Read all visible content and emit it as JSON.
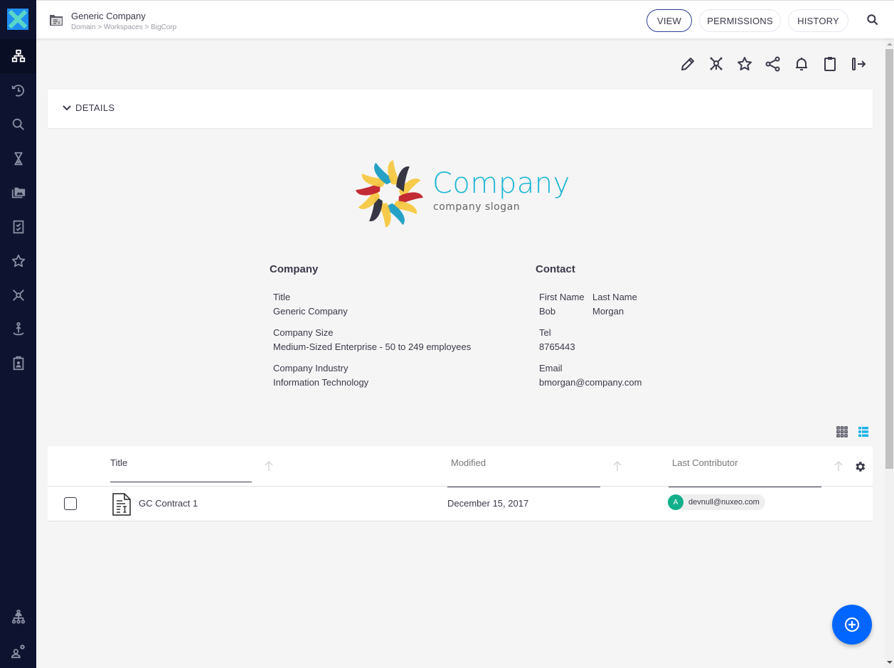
{
  "header": {
    "title": "Generic Company",
    "breadcrumb": "Domain > Workspaces > BigCorp",
    "tabs": [
      {
        "label": "VIEW",
        "active": true
      },
      {
        "label": "PERMISSIONS",
        "active": false
      },
      {
        "label": "HISTORY",
        "active": false
      }
    ]
  },
  "sidebar": {
    "items": [
      {
        "icon": "browse-tree-icon",
        "active": true
      },
      {
        "icon": "recent-history-icon"
      },
      {
        "icon": "search-icon"
      },
      {
        "icon": "hourglass-icon"
      },
      {
        "icon": "gallery-icon"
      },
      {
        "icon": "tasks-icon"
      },
      {
        "icon": "star-icon"
      },
      {
        "icon": "collections-icon"
      },
      {
        "icon": "personal-workspace-icon"
      },
      {
        "icon": "clipboard-user-icon"
      }
    ],
    "bottom_items": [
      {
        "icon": "org-chart-icon"
      },
      {
        "icon": "user-settings-icon"
      }
    ]
  },
  "actions": [
    "edit",
    "add-to-collection",
    "favorite",
    "share",
    "subscribe",
    "add-to-clipboard",
    "export"
  ],
  "details": {
    "toggle_label": "DETAILS"
  },
  "logo": {
    "name": "Company",
    "slogan": "company slogan",
    "colors": [
      "#f5c842",
      "#c0202a",
      "#1a9dc4",
      "#2b2b3a"
    ]
  },
  "company": {
    "heading": "Company",
    "fields": [
      {
        "label": "Title",
        "value": "Generic Company"
      },
      {
        "label": "Company Size",
        "value": "Medium-Sized Enterprise - 50 to 249 employees"
      },
      {
        "label": "Company Industry",
        "value": "Information Technology"
      }
    ]
  },
  "contact": {
    "heading": "Contact",
    "first_name_label": "First Name",
    "first_name": "Bob",
    "last_name_label": "Last Name",
    "last_name": "Morgan",
    "tel_label": "Tel",
    "tel": "8765443",
    "email_label": "Email",
    "email": "bmorgan@company.com"
  },
  "table": {
    "columns": [
      {
        "label": "Title"
      },
      {
        "label": "Modified"
      },
      {
        "label": "Last Contributor"
      }
    ],
    "rows": [
      {
        "title": "GC Contract 1",
        "modified": "December 15, 2017",
        "contributor_initial": "A",
        "contributor": "devnull@nuxeo.com"
      }
    ]
  },
  "colors": {
    "sidebar": "#0e1330",
    "accent": "#0066ff",
    "active_tab_border": "#2c3e96",
    "logo_teal": "#1ab6d4",
    "avatar": "#11b08a",
    "list_view_active": "#1ab2e8"
  }
}
